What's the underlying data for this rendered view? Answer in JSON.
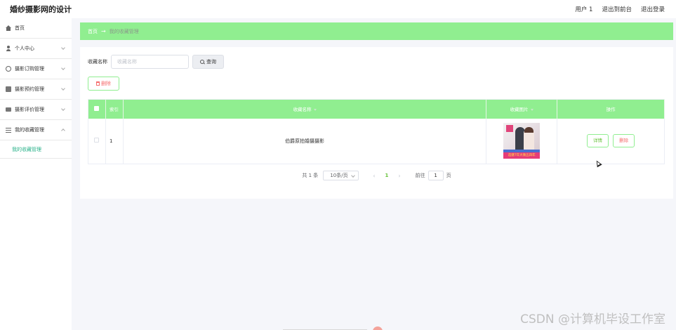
{
  "header": {
    "brand": "婚纱摄影网的设计",
    "links": [
      "用户 1",
      "退出到前台",
      "退出登录"
    ]
  },
  "sidebar": {
    "items": [
      {
        "label": "首页",
        "icon": "home-icon"
      },
      {
        "label": "个人中心",
        "icon": "user-icon"
      },
      {
        "label": "摄影订购管理",
        "icon": "gear-icon"
      },
      {
        "label": "摄影预约管理",
        "icon": "calendar-icon"
      },
      {
        "label": "摄影评价管理",
        "icon": "monitor-icon"
      },
      {
        "label": "我的收藏管理",
        "icon": "list-icon"
      }
    ],
    "submenu": "我的收藏管理"
  },
  "breadcrumb": {
    "home": "首页",
    "separator": "→",
    "current": "我的收藏管理"
  },
  "search": {
    "label": "收藏名称",
    "placeholder": "收藏名称",
    "button": "查询"
  },
  "toolbar": {
    "delete_label": "删除"
  },
  "table": {
    "headers": [
      "索引",
      "收藏名称",
      "收藏图片",
      "操作"
    ],
    "rows": [
      {
        "index": "1",
        "name": "伯爵原拍婚摄摄影",
        "image_banner": "选健7年大微五四年",
        "actions": [
          "详情",
          "删除"
        ]
      }
    ]
  },
  "pagination": {
    "total": "共 1 条",
    "page_size": "10条/页",
    "prev": "‹",
    "current_page": "1",
    "next": "›",
    "goto_label": "前往",
    "goto_value": "1",
    "page_suffix": "页"
  },
  "watermark": "CSDN @计算机毕设工作室",
  "colors": {
    "accent": "#90ee90",
    "active_menu": "#2ab28a",
    "danger": "#f56c6c",
    "success": "#67c23a"
  }
}
